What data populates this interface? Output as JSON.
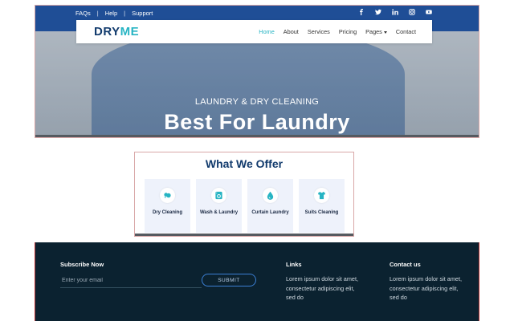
{
  "topbar": {
    "links": [
      "FAQs",
      "Help",
      "Support"
    ],
    "separator": "|",
    "social_icons": [
      "facebook-icon",
      "twitter-icon",
      "linkedin-icon",
      "instagram-icon",
      "youtube-icon"
    ]
  },
  "navbar": {
    "logo_main": "DRY",
    "logo_accent": "ME",
    "items": [
      {
        "label": "Home",
        "active": true
      },
      {
        "label": "About"
      },
      {
        "label": "Services"
      },
      {
        "label": "Pricing"
      },
      {
        "label": "Pages",
        "dropdown": true
      },
      {
        "label": "Contact"
      }
    ]
  },
  "hero": {
    "subtitle": "LAUNDRY & DRY CLEANING",
    "title": "Best For Laundry"
  },
  "offer": {
    "title": "What We Offer",
    "cards": [
      {
        "label": "Dry Cleaning",
        "icon": "dry-cleaning-icon"
      },
      {
        "label": "Wash & Laundry",
        "icon": "washing-machine-icon"
      },
      {
        "label": "Curtain Laundry",
        "icon": "water-drop-icon"
      },
      {
        "label": "Suits Cleaning",
        "icon": "shirt-icon"
      }
    ]
  },
  "footer": {
    "subscribe_heading": "Subscribe Now",
    "email_placeholder": "Enter your email",
    "submit_label": "SUBMIT",
    "links_heading": "Links",
    "links_text": "Lorem ipsum dolor sit amet, consectetur adipiscing elit, sed do",
    "contact_heading": "Contact us",
    "contact_text": "Lorem ipsum dolor sit amet, consectetur adipiscing elit, sed do"
  },
  "colors": {
    "topbar": "#1f4e96",
    "brand_dark": "#123b6d",
    "accent": "#27b4c3",
    "footer_bg": "#0b2230"
  }
}
